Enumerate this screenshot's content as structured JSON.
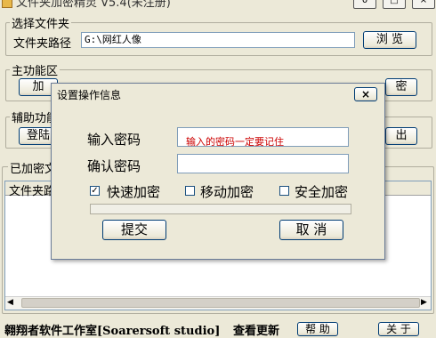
{
  "window": {
    "title": "文件夹加密精灵 V5.4(未注册)",
    "minimize": "0",
    "maximize": "□",
    "close": "×"
  },
  "folder_group": {
    "label": "选择文件夹",
    "path_label": "文件夹路径",
    "path_value": "G:\\网红人像",
    "browse_button": "浏 览"
  },
  "main_group": {
    "label": "主功能区",
    "encrypt_button": "加",
    "decrypt_button": "密"
  },
  "aux_group": {
    "label": "辅助功能",
    "login_button": "登陆",
    "exit_button": "出"
  },
  "encrypted_group": {
    "label": "已加密文",
    "column_header": "文件夹路"
  },
  "footer": {
    "studio": "翱翔者软件工作室[Soarersoft studio]",
    "check_update": "查看更新",
    "help_button": "帮 助",
    "about_button": "关 于"
  },
  "dialog": {
    "title": "设置操作信息",
    "close_glyph": "×",
    "password_label": "输入密码",
    "password_hint": "输入的密码一定要记住",
    "password_hint_color": "#cc0000",
    "confirm_label": "确认密码",
    "confirm_value": "",
    "checkbox_quick": {
      "label": "快速加密",
      "checked": true
    },
    "checkbox_mobile": {
      "label": "移动加密",
      "checked": false
    },
    "checkbox_safe": {
      "label": "安全加密",
      "checked": false
    },
    "submit_button": "提交",
    "cancel_button": "取 消"
  }
}
